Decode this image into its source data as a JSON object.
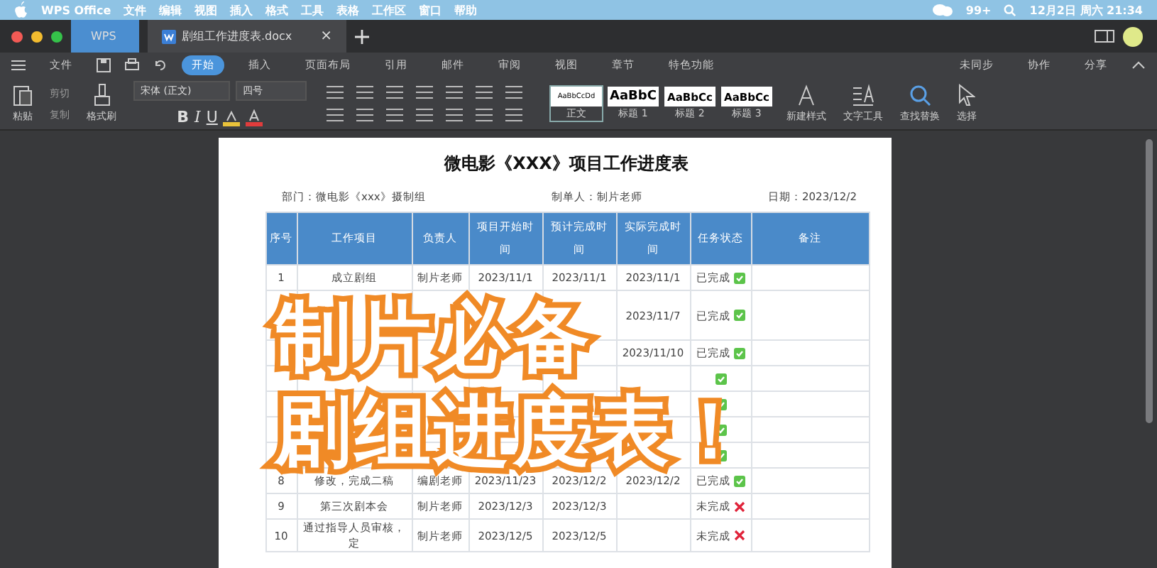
{
  "menu_bar": {
    "app": "WPS Office",
    "items": [
      "文件",
      "编辑",
      "视图",
      "插入",
      "格式",
      "工具",
      "表格",
      "工作区",
      "窗口",
      "帮助"
    ],
    "badge": "99+",
    "clock": "12月2日 周六 21:34"
  },
  "tabs": [
    {
      "label": "WPS",
      "selected": false,
      "kind": "home"
    },
    {
      "label": "剧组工作进度表.docx",
      "selected": true,
      "kind": "doc",
      "close": "×"
    }
  ],
  "ribbon": {
    "menu_label": "文件",
    "tabs": [
      {
        "label": "开始",
        "selected": true
      },
      {
        "label": "插入",
        "selected": false
      },
      {
        "label": "页面布局",
        "selected": false
      },
      {
        "label": "引用",
        "selected": false
      },
      {
        "label": "邮件",
        "selected": false
      },
      {
        "label": "审阅",
        "selected": false
      },
      {
        "label": "视图",
        "selected": false
      },
      {
        "label": "章节",
        "selected": false
      },
      {
        "label": "特色功能",
        "selected": false
      }
    ],
    "right_actions": [
      "未同步",
      "协作",
      "分享"
    ],
    "format_buttons": [
      "B",
      "I",
      "U"
    ],
    "paste": "粘贴",
    "cut": "剪切",
    "copy": "复制",
    "format_painter": "格式刷",
    "font": "宋体 (正文)",
    "size": "四号",
    "styles": [
      {
        "preview": "AaBbCcDd",
        "name": "正文",
        "selected": true
      },
      {
        "preview": "AaBbC",
        "name": "标题 1",
        "selected": false
      },
      {
        "preview": "AaBbCc",
        "name": "标题 2",
        "selected": false
      },
      {
        "preview": "AaBbCc",
        "name": "标题 3",
        "selected": false
      }
    ],
    "tools": [
      "新建样式",
      "文字工具",
      "查找替换",
      "选择"
    ]
  },
  "document": {
    "title": "微电影《XXX》项目工作进度表",
    "info": [
      "部门：微电影《xxx》摄制组",
      "制单人：制片老师",
      "日期：2023/12/2"
    ],
    "columns": [
      "序号",
      "工作项目",
      "负责人",
      "项目开始时间",
      "预计完成时间",
      "实际完成时间",
      "任务状态",
      "备注"
    ],
    "rows": [
      {
        "no": "1",
        "item": "成立剧组",
        "owner": "制片老师",
        "start": "2023/11/1",
        "planned": "2023/11/1",
        "actual": "2023/11/1",
        "status": "已完成",
        "done": true
      },
      {
        "actual": "2023/11/7",
        "status": "已完成",
        "done": true
      },
      {
        "actual": "2023/11/10",
        "status": "已完成",
        "done": true
      },
      {
        "done": true
      },
      {
        "done": true
      },
      {
        "done": true
      },
      {
        "done": true
      },
      {
        "no": "8",
        "item": "修改，完成二稿",
        "owner": "编剧老师",
        "start": "2023/11/23",
        "planned": "2023/12/2",
        "actual": "2023/12/2",
        "status": "已完成",
        "done": true
      },
      {
        "no": "9",
        "item": "第三次剧本会",
        "owner": "制片老师",
        "start": "2023/12/3",
        "planned": "2023/12/3",
        "status": "未完成",
        "done": false
      },
      {
        "no": "10",
        "item": "通过指导人员审核，定",
        "owner": "制片老师",
        "start": "2023/12/5",
        "planned": "2023/12/5",
        "status": "未完成",
        "done": false
      }
    ]
  },
  "overlay": {
    "lines": [
      "制片必备",
      "剧组进度表！"
    ]
  }
}
